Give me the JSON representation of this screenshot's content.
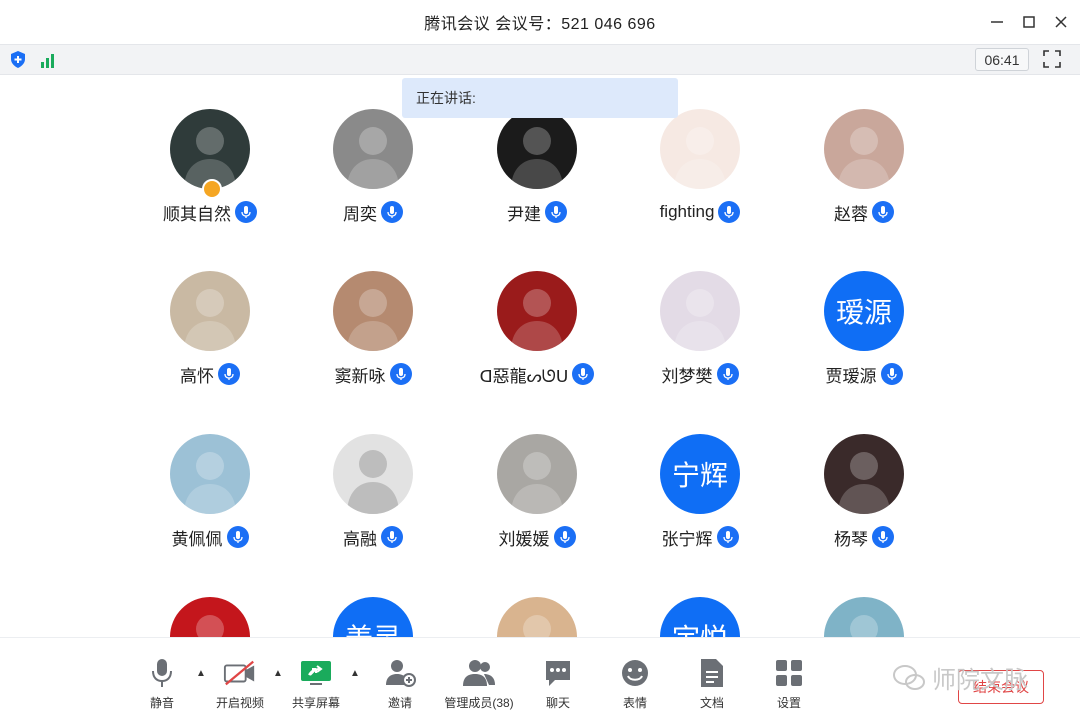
{
  "window": {
    "title": "腾讯会议 会议号：521 046 696"
  },
  "status": {
    "timer": "06:41"
  },
  "speaking": {
    "label": "正在讲话:"
  },
  "participants": [
    {
      "name": "顺其自然",
      "type": "photo",
      "bg": "#2f3b3a",
      "host": true
    },
    {
      "name": "周奕",
      "type": "photo",
      "bg": "#8a8a8a"
    },
    {
      "name": "尹建",
      "type": "photo",
      "bg": "#1b1b1b"
    },
    {
      "name": "fighting",
      "type": "photo",
      "bg": "#f6e9e3"
    },
    {
      "name": "赵蓉",
      "type": "photo",
      "bg": "#c9a79b"
    },
    {
      "name": "高怀",
      "type": "photo",
      "bg": "#c9b9a3"
    },
    {
      "name": "窦新咏",
      "type": "photo",
      "bg": "#b58a70"
    },
    {
      "name": "ᗡ惡龍ᔕᘎᑌ",
      "type": "photo",
      "bg": "#9a1b1b"
    },
    {
      "name": "刘梦樊",
      "type": "photo",
      "bg": "#e3dbe6"
    },
    {
      "name": "贾瑷源",
      "type": "text",
      "avatar_text": "瑷源",
      "bg": "#0f6ef5"
    },
    {
      "name": "黄佩佩",
      "type": "photo",
      "bg": "#9cc1d6"
    },
    {
      "name": "高融",
      "type": "default",
      "bg": "#e2e2e2"
    },
    {
      "name": "刘媛媛",
      "type": "photo",
      "bg": "#a9a7a3"
    },
    {
      "name": "张宁辉",
      "type": "text",
      "avatar_text": "宁辉",
      "bg": "#0f6ef5"
    },
    {
      "name": "杨琴",
      "type": "photo",
      "bg": "#3a2a2a"
    },
    {
      "name": "",
      "type": "photo",
      "bg": "#c4161c"
    },
    {
      "name": "",
      "type": "text",
      "avatar_text": "姜灵",
      "bg": "#0f6ef5"
    },
    {
      "name": "",
      "type": "photo",
      "bg": "#d9b48f"
    },
    {
      "name": "",
      "type": "text",
      "avatar_text": "宇悦",
      "bg": "#0f6ef5"
    },
    {
      "name": "",
      "type": "photo",
      "bg": "#7fb3c7"
    }
  ],
  "toolbar": {
    "mute": "静音",
    "video": "开启视频",
    "share": "共享屏幕",
    "invite": "邀请",
    "members": "管理成员(38)",
    "chat": "聊天",
    "emoji": "表情",
    "docs": "文档",
    "settings": "设置",
    "end": "结束会议"
  },
  "watermark": "师院文脉",
  "colors": {
    "accent": "#1b6ff5",
    "danger": "#e04646",
    "share_green": "#1aab5c",
    "video_red": "#e04646"
  }
}
